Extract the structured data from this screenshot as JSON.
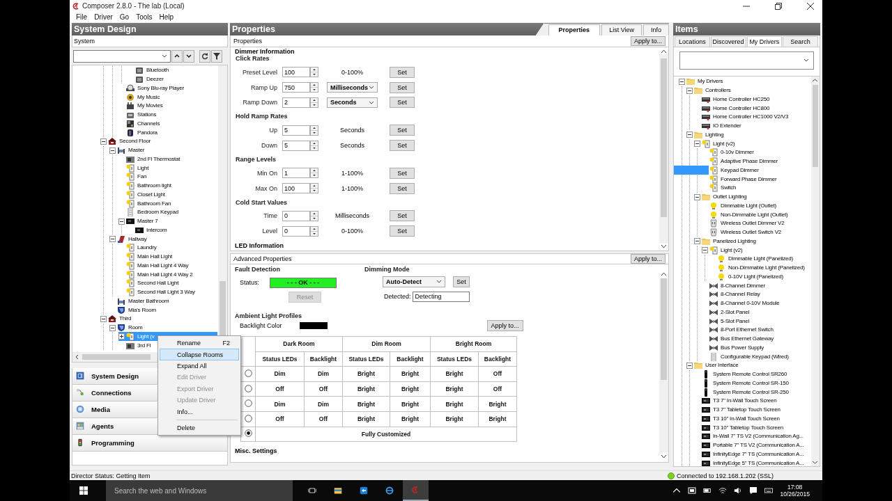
{
  "window": {
    "title": "Composer 2.8.0 - The lab (Local)"
  },
  "menu": [
    "File",
    "Driver",
    "Go",
    "Tools",
    "Help"
  ],
  "system_design": {
    "title": "System Design",
    "label": "System",
    "tree": [
      {
        "children": [
          {
            "children": [
              {
                "children": [
                  {
                    "label": "Bluetooth",
                    "kind": "speaker",
                    "selected": false
                  },
                  {
                    "label": "Deezer",
                    "kind": "speaker",
                    "selected": false
                  }
                ]
              },
              {
                "label": "Sony Blu-ray Player",
                "kind": "disc",
                "selected": false
              },
              {
                "label": "My Music",
                "kind": "music",
                "selected": false
              },
              {
                "label": "My Movies",
                "kind": "movies",
                "selected": false
              },
              {
                "label": "Stations",
                "kind": "radio",
                "selected": false
              },
              {
                "label": "Channels",
                "kind": "channels",
                "selected": false
              },
              {
                "label": "Pandora",
                "kind": "app",
                "selected": false
              }
            ]
          }
        ]
      },
      {
        "label": "Second Floor",
        "kind": "floor",
        "expanded": true,
        "selected": false,
        "children": [
          {
            "label": "Master",
            "kind": "bedroom",
            "expanded": true,
            "selected": false,
            "children": [
              {
                "label": "2nd Fl Thermostat",
                "kind": "thermostat",
                "selected": false
              },
              {
                "label": "Light",
                "kind": "light",
                "selected": false
              },
              {
                "label": "Fan",
                "kind": "light",
                "selected": false
              },
              {
                "label": "Bathroom light",
                "kind": "light",
                "selected": false
              },
              {
                "label": "Closet Light",
                "kind": "light",
                "selected": false
              },
              {
                "label": "Bathroom Fan",
                "kind": "light",
                "selected": false
              },
              {
                "label": "Bedroom Keypad",
                "kind": "keypad",
                "selected": false
              },
              {
                "label": "Master 7",
                "kind": "screen",
                "expanded": true,
                "selected": false,
                "children": [
                  {
                    "label": "Intercom",
                    "kind": "screen",
                    "selected": false
                  }
                ]
              }
            ]
          },
          {
            "label": "Hallway",
            "kind": "hall",
            "expanded": true,
            "selected": false,
            "children": [
              {
                "label": "Laundry",
                "kind": "light",
                "selected": false
              },
              {
                "label": "Main Hall Light",
                "kind": "light",
                "selected": false
              },
              {
                "label": "Main Hall Light 4 Way",
                "kind": "light",
                "selected": false
              },
              {
                "label": "Main Hall Light 4 Way 2",
                "kind": "light",
                "selected": false
              },
              {
                "label": "Second Hall Light",
                "kind": "light",
                "selected": false
              },
              {
                "label": "Second Hall Light 3 Way",
                "kind": "light",
                "selected": false
              }
            ]
          },
          {
            "label": "Master Bathroom",
            "kind": "bedroom",
            "selected": false
          },
          {
            "label": "Mia's Room",
            "kind": "shield",
            "selected": false
          }
        ]
      },
      {
        "label": "Third",
        "kind": "floor",
        "expanded": true,
        "selected": false,
        "children": [
          {
            "label": "Room",
            "kind": "shield",
            "expanded": true,
            "selected": false,
            "children": [
              {
                "label": "Light (v",
                "kind": "light",
                "expanded": false,
                "selected": true
              },
              {
                "label": "3rd Fl",
                "kind": "thermostat",
                "selected": false
              }
            ]
          }
        ]
      }
    ],
    "nav": [
      {
        "label": "System Design",
        "kind": "system"
      },
      {
        "label": "Connections",
        "kind": "connections"
      },
      {
        "label": "Media",
        "kind": "media"
      },
      {
        "label": "Agents",
        "kind": "agents"
      },
      {
        "label": "Programming",
        "kind": "programming"
      }
    ]
  },
  "context_menu": [
    {
      "kind": "item",
      "label": "Rename",
      "shortcut": "F2",
      "disabled": false,
      "highlighted": false
    },
    {
      "kind": "item",
      "label": "Collapse Rooms",
      "disabled": false,
      "highlighted": true
    },
    {
      "kind": "item",
      "label": "Expand All",
      "disabled": false,
      "highlighted": false
    },
    {
      "kind": "item",
      "label": "Edit Driver",
      "disabled": true,
      "highlighted": false
    },
    {
      "kind": "item",
      "label": "Export Driver",
      "disabled": true,
      "highlighted": false
    },
    {
      "kind": "item",
      "label": "Update Driver",
      "disabled": true,
      "highlighted": false
    },
    {
      "kind": "item",
      "label": "Info...",
      "disabled": false,
      "highlighted": false
    },
    {
      "kind": "separator"
    },
    {
      "kind": "item",
      "label": "Delete",
      "disabled": false,
      "highlighted": false
    }
  ],
  "properties": {
    "title": "Properties",
    "tabs": [
      {
        "label": "Properties",
        "selected": true
      },
      {
        "label": "List View",
        "selected": false
      },
      {
        "label": "Info",
        "selected": false
      }
    ],
    "section_label": "Properties",
    "apply_button": "Apply to...",
    "group_title": "Dimmer Information",
    "sections": [
      {
        "title": "Click Rates",
        "rows": [
          {
            "label": "Preset Level",
            "value": "100",
            "kind": "text",
            "unit": "0-100%",
            "button": "Set"
          },
          {
            "label": "Ramp Up",
            "value": "750",
            "kind": "dropdown",
            "unit": "Milliseconds",
            "button": "Set"
          },
          {
            "label": "Ramp Down",
            "value": "2",
            "kind": "dropdown",
            "unit": "Seconds",
            "button": "Set"
          }
        ]
      },
      {
        "title": "Hold Ramp Rates",
        "rows": [
          {
            "label": "Up",
            "value": "5",
            "kind": "text",
            "unit": "Seconds",
            "button": "Set"
          },
          {
            "label": "Down",
            "value": "5",
            "kind": "text",
            "unit": "Seconds",
            "button": "Set"
          }
        ]
      },
      {
        "title": "Range Levels",
        "rows": [
          {
            "label": "Min On",
            "value": "1",
            "kind": "text",
            "unit": "1-100%",
            "button": "Set"
          },
          {
            "label": "Max On",
            "value": "100",
            "kind": "text",
            "unit": "1-100%",
            "button": "Set"
          }
        ]
      },
      {
        "title": "Cold Start Values",
        "rows": [
          {
            "label": "Time",
            "value": "0",
            "kind": "text",
            "unit": "Milliseconds",
            "button": "Set"
          },
          {
            "label": "Level",
            "value": "0",
            "kind": "text",
            "unit": "0-100%",
            "button": "Set"
          }
        ]
      }
    ],
    "collapsed_group": "LED Information",
    "advanced": {
      "label": "Advanced Properties",
      "apply_button": "Apply to...",
      "fault_detection": {
        "title": "Fault Detection",
        "status_label": "Status:",
        "status": "- - - OK - - -",
        "status_ok": true,
        "reset_button": "Reset",
        "reset_disabled": true
      },
      "dimming_mode": {
        "title": "Dimming Mode",
        "mode": "Auto-Detect",
        "set_button": "Set",
        "detected_label": "Detected:",
        "detected": "Detecting"
      },
      "ambient": {
        "title": "Ambient Light Profiles",
        "backlight_label": "Backlight Color",
        "apply_button": "Apply to...",
        "groups": [
          "Dark Room",
          "Dim Room",
          "Bright Room"
        ],
        "columns": [
          "Status LEDs",
          "Backlight",
          "Status LEDs",
          "Backlight",
          "Status LEDs",
          "Backlight"
        ],
        "profiles": [
          {
            "cells": [
              "Dim",
              "Dim",
              "Bright",
              "Bright",
              "Bright",
              "Off"
            ],
            "selected": false
          },
          {
            "cells": [
              "Off",
              "Off",
              "Bright",
              "Bright",
              "Bright",
              "Off"
            ],
            "selected": false
          },
          {
            "cells": [
              "Dim",
              "Dim",
              "Bright",
              "Bright",
              "Bright",
              "Bright"
            ],
            "selected": false
          },
          {
            "cells": [
              "Off",
              "Off",
              "Bright",
              "Bright",
              "Bright",
              "Bright"
            ],
            "selected": false
          },
          {
            "custom": "Fully Customized",
            "selected": true
          }
        ]
      },
      "collapsed_group": "Misc. Settings"
    }
  },
  "items": {
    "title": "Items",
    "tabs": [
      {
        "label": "Locations",
        "selected": false
      },
      {
        "label": "Discovered",
        "selected": false
      },
      {
        "label": "My Drivers",
        "selected": true
      },
      {
        "label": "Search",
        "selected": false
      }
    ],
    "tree": [
      {
        "label": "My Drivers",
        "kind": "folder",
        "expanded": true,
        "selected": false,
        "children": [
          {
            "label": "Controllers",
            "kind": "folder",
            "expanded": true,
            "selected": false,
            "children": [
              {
                "label": "Home Controller HC250",
                "kind": "controller",
                "selected": false
              },
              {
                "label": "Home Controller HC800",
                "kind": "controller",
                "selected": false
              },
              {
                "label": "Home Controller HC1000 V2/V3",
                "kind": "controller",
                "selected": false
              },
              {
                "label": "IO Extender",
                "kind": "controller",
                "selected": false
              }
            ]
          },
          {
            "label": "Lighting",
            "kind": "folder",
            "expanded": true,
            "selected": false,
            "children": [
              {
                "label": "Light (v2)",
                "kind": "light",
                "expanded": true,
                "selected": false,
                "children": [
                  {
                    "label": "0-10v Dimmer",
                    "kind": "light",
                    "selected": false
                  },
                  {
                    "label": "Adaptive Phase Dimmer",
                    "kind": "light",
                    "selected": false
                  },
                  {
                    "label": "Keypad Dimmer",
                    "kind": "light",
                    "selected": true
                  },
                  {
                    "label": "Forward Phase Dimmer",
                    "kind": "light",
                    "selected": false
                  },
                  {
                    "label": "Switch",
                    "kind": "light",
                    "selected": false
                  }
                ]
              },
              {
                "label": "Outlet Lighting",
                "kind": "folder",
                "expanded": true,
                "selected": false,
                "children": [
                  {
                    "label": "Dimmable Light (Outlet)",
                    "kind": "bulb",
                    "selected": false
                  },
                  {
                    "label": "Non-Dimmable Light (Outlet)",
                    "kind": "bulb",
                    "selected": false
                  },
                  {
                    "label": "Wireless Outlet Dimmer V2",
                    "kind": "outlet",
                    "selected": false
                  },
                  {
                    "label": "Wireless Outlet Switch V2",
                    "kind": "outlet",
                    "selected": false
                  }
                ]
              },
              {
                "label": "Panelized Lighting",
                "kind": "folder",
                "expanded": true,
                "selected": false,
                "children": [
                  {
                    "label": "Light (v2)",
                    "kind": "light",
                    "expanded": true,
                    "selected": false,
                    "children": [
                      {
                        "label": "Dimmable Light (Panelized)",
                        "kind": "bulb",
                        "selected": false
                      },
                      {
                        "label": "Non-Dimmable Light (Panelized)",
                        "kind": "bulb",
                        "selected": false
                      },
                      {
                        "label": "0-10V Light (Panelized)",
                        "kind": "bulb",
                        "selected": false
                      }
                    ]
                  },
                  {
                    "label": "8-Channel Dimmer",
                    "kind": "panel",
                    "selected": false
                  },
                  {
                    "label": "8-Channel Relay",
                    "kind": "panel",
                    "selected": false
                  },
                  {
                    "label": "8-Channel 0-10V Module",
                    "kind": "panel",
                    "selected": false
                  },
                  {
                    "label": "2-Slot Panel",
                    "kind": "panel",
                    "selected": false
                  },
                  {
                    "label": "5-Slot Panel",
                    "kind": "panel",
                    "selected": false
                  },
                  {
                    "label": "8-Port Ethernet Switch",
                    "kind": "panel",
                    "selected": false
                  },
                  {
                    "label": "Bus Ethernet Gateway",
                    "kind": "panel",
                    "selected": false
                  },
                  {
                    "label": "Bus Power Supply",
                    "kind": "panel",
                    "selected": false
                  },
                  {
                    "label": "Configurable Keypad (Wired)",
                    "kind": "keypad",
                    "selected": false
                  }
                ]
              }
            ]
          },
          {
            "label": "User Interface",
            "kind": "folder",
            "expanded": true,
            "selected": false,
            "children": [
              {
                "label": "System Remote Control SR260",
                "kind": "remote",
                "selected": false
              },
              {
                "label": "System Remote Control SR-150",
                "kind": "remote",
                "selected": false
              },
              {
                "label": "System Remote Control SR-250",
                "kind": "remote",
                "selected": false
              },
              {
                "label": "T3 7\" In-Wall Touch Screen",
                "kind": "touchscreen",
                "selected": false
              },
              {
                "label": "T3 7\" Tabletop Touch Screen",
                "kind": "touchscreen",
                "selected": false
              },
              {
                "label": "T3 10\" In-Wall Touch Screen",
                "kind": "touchscreen",
                "selected": false
              },
              {
                "label": "T3 10\" Tabletop Touch Screen",
                "kind": "touchscreen",
                "selected": false
              },
              {
                "label": "In-Wall 7\" TS V2 (Communication Ag...",
                "kind": "touchscreen",
                "selected": false
              },
              {
                "label": "Portable 7\" TS V2 (Communication A...",
                "kind": "touchscreen",
                "selected": false
              },
              {
                "label": "InfinityEdge 7\" TS (Communication A...",
                "kind": "touchscreen",
                "selected": false
              },
              {
                "label": "InfinityEdge 5\" TS (Communication A...",
                "kind": "touchscreen",
                "selected": false
              }
            ]
          }
        ]
      }
    ]
  },
  "status_bar": {
    "left": "Director Status: Getting Item",
    "right": "Connected to 192.168.1.202 (SSL)",
    "connected": true
  },
  "taskbar": {
    "search_placeholder": "Search the web and Windows",
    "apps": [
      {
        "kind": "task-view",
        "active": false
      },
      {
        "kind": "explorer",
        "active": false
      },
      {
        "kind": "remote",
        "active": false
      },
      {
        "kind": "browser",
        "active": false
      },
      {
        "kind": "composer",
        "active": true
      }
    ],
    "time": "17:08",
    "date": "10/26/2015"
  }
}
